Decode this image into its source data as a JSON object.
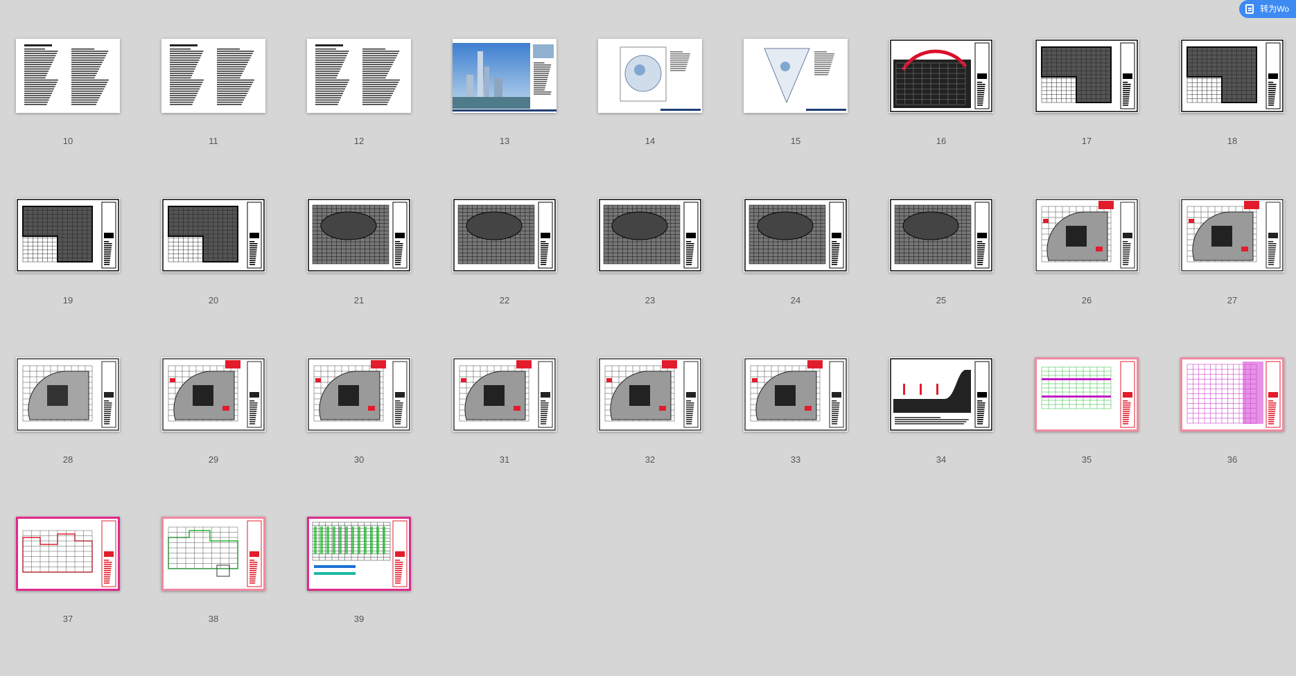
{
  "toolbar": {
    "convert_label": "转为Wo",
    "convert_icon": "document-convert-icon"
  },
  "pages": [
    {
      "num": "10",
      "kind": "text"
    },
    {
      "num": "11",
      "kind": "text"
    },
    {
      "num": "12",
      "kind": "text"
    },
    {
      "num": "13",
      "kind": "photo"
    },
    {
      "num": "14",
      "kind": "plan-light"
    },
    {
      "num": "15",
      "kind": "plan-triangle"
    },
    {
      "num": "16",
      "kind": "cad-site-red"
    },
    {
      "num": "17",
      "kind": "cad-L"
    },
    {
      "num": "18",
      "kind": "cad-L"
    },
    {
      "num": "19",
      "kind": "cad-L"
    },
    {
      "num": "20",
      "kind": "cad-L"
    },
    {
      "num": "21",
      "kind": "cad-dense"
    },
    {
      "num": "22",
      "kind": "cad-dense"
    },
    {
      "num": "23",
      "kind": "cad-dense"
    },
    {
      "num": "24",
      "kind": "cad-dense"
    },
    {
      "num": "25",
      "kind": "cad-dense"
    },
    {
      "num": "26",
      "kind": "cad-red-gray"
    },
    {
      "num": "27",
      "kind": "cad-red-gray"
    },
    {
      "num": "28",
      "kind": "cad-gray"
    },
    {
      "num": "29",
      "kind": "cad-red-gray"
    },
    {
      "num": "30",
      "kind": "cad-red-gray"
    },
    {
      "num": "31",
      "kind": "cad-red-gray"
    },
    {
      "num": "32",
      "kind": "cad-red-gray"
    },
    {
      "num": "33",
      "kind": "cad-red-gray"
    },
    {
      "num": "34",
      "kind": "cad-section"
    },
    {
      "num": "35",
      "kind": "cad-green-magenta"
    },
    {
      "num": "36",
      "kind": "cad-magenta"
    },
    {
      "num": "37",
      "kind": "cad-red-elevation"
    },
    {
      "num": "38",
      "kind": "cad-green-elevation"
    },
    {
      "num": "39",
      "kind": "cad-table"
    }
  ]
}
